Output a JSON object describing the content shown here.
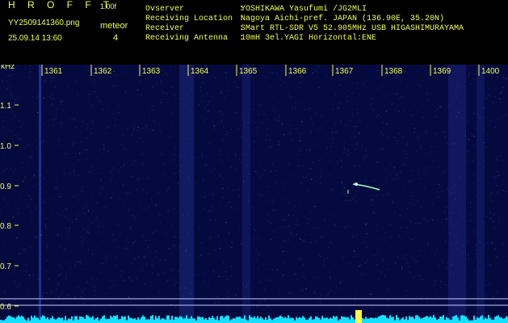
{
  "header": {
    "app_title": "H R O F F T",
    "version": "1.00f",
    "file_name": "YY2509141360.png",
    "meteor_label": "meteor",
    "meteor_count": "4",
    "date_time": "25.09.14 13:60",
    "info": [
      {
        "key": "Ovserver",
        "value": "YOSHIKAWA Yasufumi /JG2MLI"
      },
      {
        "key": "Receiving Location",
        "value": "Nagoya Aichi-pref. JAPAN (136.90E, 35.20N)"
      },
      {
        "key": "Receiver",
        "value": "SMart RTL-SDR V5 52.905MHz USB HIGASHIMURAYAMA"
      },
      {
        "key": "Receiving Antenna",
        "value": "10mH 3el.YAGI Horizontal:ENE"
      }
    ]
  },
  "spectrogram": {
    "unit_label": "kHz",
    "y_ticks": [
      "1.1",
      "1.0",
      "0.9",
      "0.8",
      "0.7",
      "0.6"
    ],
    "x_ticks": [
      "1361",
      "1362",
      "1363",
      "1364",
      "1365",
      "1366",
      "1367",
      "1368",
      "1369",
      "1400"
    ],
    "colors": {
      "background": "#050a3e",
      "noise": "#2a3bb0",
      "meteor": "#9fffc0",
      "signal_bar": "#12e0ff",
      "spike": "#ffff40",
      "labels": "#f2ff4d"
    }
  }
}
